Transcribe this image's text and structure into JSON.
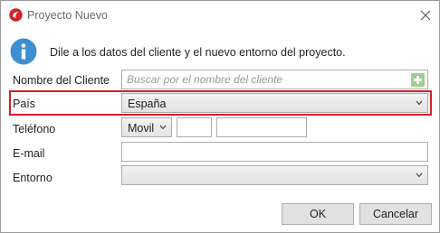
{
  "window": {
    "title": "Proyecto Nuevo"
  },
  "info": {
    "text": "Dile a los datos del cliente y el nuevo entorno del proyecto."
  },
  "form": {
    "client": {
      "label": "Nombre del Cliente",
      "placeholder": "Buscar por el nombre del cliente",
      "value": ""
    },
    "country": {
      "label": "País",
      "selected": "España"
    },
    "phone": {
      "label": "Teléfono",
      "type_selected": "Movil",
      "prefix": "",
      "number": ""
    },
    "email": {
      "label": "E-mail",
      "value": ""
    },
    "environment": {
      "label": "Entorno",
      "selected": ""
    }
  },
  "buttons": {
    "ok": "OK",
    "cancel": "Cancelar"
  },
  "colors": {
    "highlight": "#d7202a",
    "info_icon": "#3d8fd1",
    "app_icon": "#d61f26",
    "add_button": "#9fcf8c"
  }
}
